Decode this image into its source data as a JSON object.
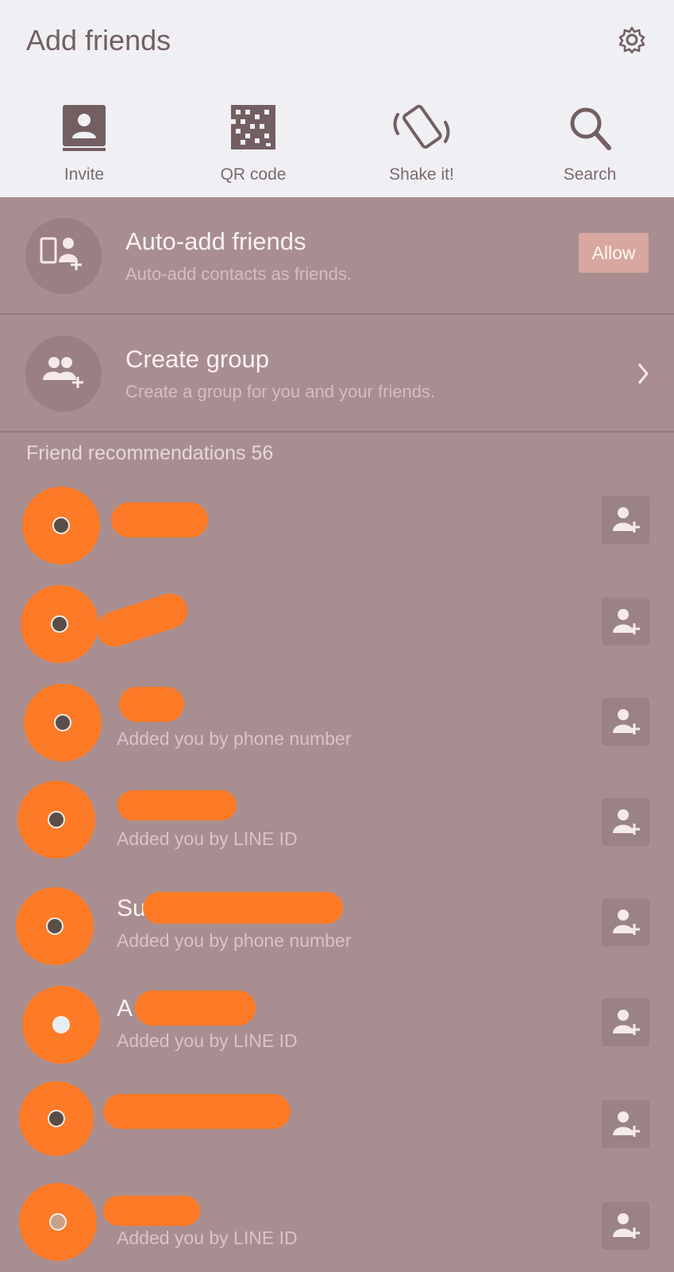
{
  "header": {
    "title": "Add friends",
    "actions": [
      {
        "label": "Invite",
        "icon": "contact-book-icon"
      },
      {
        "label": "QR code",
        "icon": "qr-code-icon"
      },
      {
        "label": "Shake it!",
        "icon": "shake-phone-icon"
      },
      {
        "label": "Search",
        "icon": "search-icon"
      }
    ]
  },
  "auto_add": {
    "title": "Auto-add friends",
    "subtitle": "Auto-add contacts as friends.",
    "button": "Allow"
  },
  "create_group": {
    "title": "Create group",
    "subtitle": "Create a group for you and your friends."
  },
  "recommendations": {
    "label": "Friend recommendations 56",
    "items": [
      {
        "name": "",
        "subtitle": ""
      },
      {
        "name": "",
        "subtitle": ""
      },
      {
        "name": "",
        "subtitle": "Added you by phone number"
      },
      {
        "name": "",
        "subtitle": "Added you by LINE ID"
      },
      {
        "name": "Su",
        "subtitle": "Added you by phone number"
      },
      {
        "name": "A",
        "subtitle": "Added you by LINE ID"
      },
      {
        "name": "",
        "subtitle": ""
      },
      {
        "name": "",
        "subtitle": "Added you by LINE ID"
      }
    ]
  },
  "colors": {
    "header_bg": "#f0f0f4",
    "panel_bg": "#a88e90",
    "allow_button": "#d8a79f",
    "avatar_redaction": "#fd7a26"
  }
}
